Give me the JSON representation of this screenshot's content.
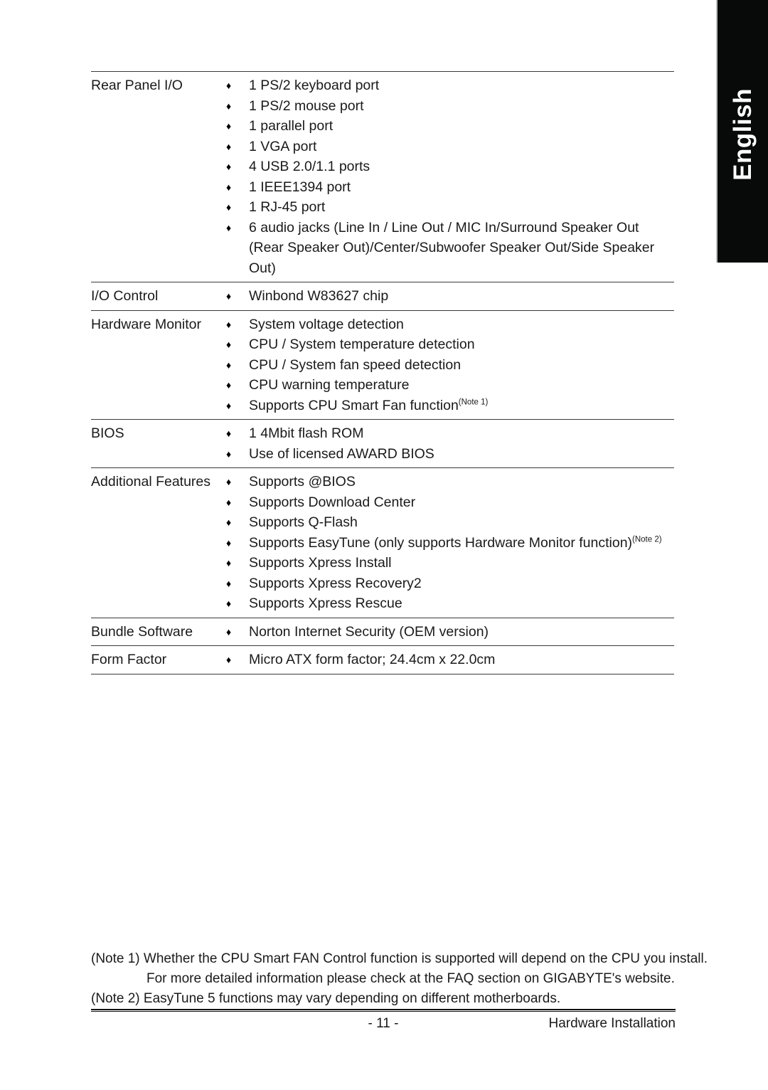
{
  "page": {
    "language_tab": "English",
    "page_number": "- 11 -",
    "section_title": "Hardware Installation"
  },
  "spec_table": {
    "rows": [
      {
        "label": "Rear Panel I/O",
        "items": [
          {
            "text": "1 PS/2 keyboard port"
          },
          {
            "text": "1 PS/2 mouse port"
          },
          {
            "text": "1 parallel port"
          },
          {
            "text": "1 VGA port"
          },
          {
            "text": "4 USB 2.0/1.1 ports"
          },
          {
            "text": "1 IEEE1394 port"
          },
          {
            "text": "1 RJ-45 port"
          },
          {
            "text": "6 audio jacks (Line In / Line Out / MIC In/Surround Speaker Out (Rear Speaker Out)/Center/Subwoofer Speaker Out/Side Speaker Out)"
          }
        ]
      },
      {
        "label": "I/O Control",
        "items": [
          {
            "text": "Winbond W83627 chip"
          }
        ]
      },
      {
        "label": "Hardware Monitor",
        "items": [
          {
            "text": "System voltage detection"
          },
          {
            "text": "CPU / System temperature detection"
          },
          {
            "text": "CPU / System fan speed detection"
          },
          {
            "text": "CPU warning temperature"
          },
          {
            "text": "Supports CPU Smart Fan function",
            "note": "(Note 1)"
          }
        ]
      },
      {
        "label": "BIOS",
        "items": [
          {
            "text": "1 4Mbit flash ROM"
          },
          {
            "text": "Use of licensed AWARD BIOS"
          }
        ]
      },
      {
        "label": "Additional Features",
        "items": [
          {
            "text": "Supports @BIOS"
          },
          {
            "text": "Supports Download Center"
          },
          {
            "text": "Supports Q-Flash"
          },
          {
            "text": "Supports EasyTune (only supports Hardware Monitor function)",
            "note": "(Note 2)"
          },
          {
            "text": "Supports Xpress Install"
          },
          {
            "text": "Supports Xpress Recovery2"
          },
          {
            "text": "Supports Xpress Rescue"
          }
        ]
      },
      {
        "label": "Bundle Software",
        "items": [
          {
            "text": "Norton Internet Security (OEM version)"
          }
        ]
      },
      {
        "label": "Form Factor",
        "items": [
          {
            "text": "Micro ATX form factor; 24.4cm x 22.0cm"
          }
        ]
      }
    ],
    "bullet_glyph": "♦"
  },
  "footnotes": [
    {
      "text": "(Note 1) Whether the CPU Smart FAN Control function is supported will depend on the CPU you install.",
      "indent": false
    },
    {
      "text": "For more detailed information please check at the FAQ section on GIGABYTE's website.",
      "indent": true
    },
    {
      "text": "(Note 2) EasyTune 5 functions may vary depending on different motherboards.",
      "indent": false
    }
  ]
}
